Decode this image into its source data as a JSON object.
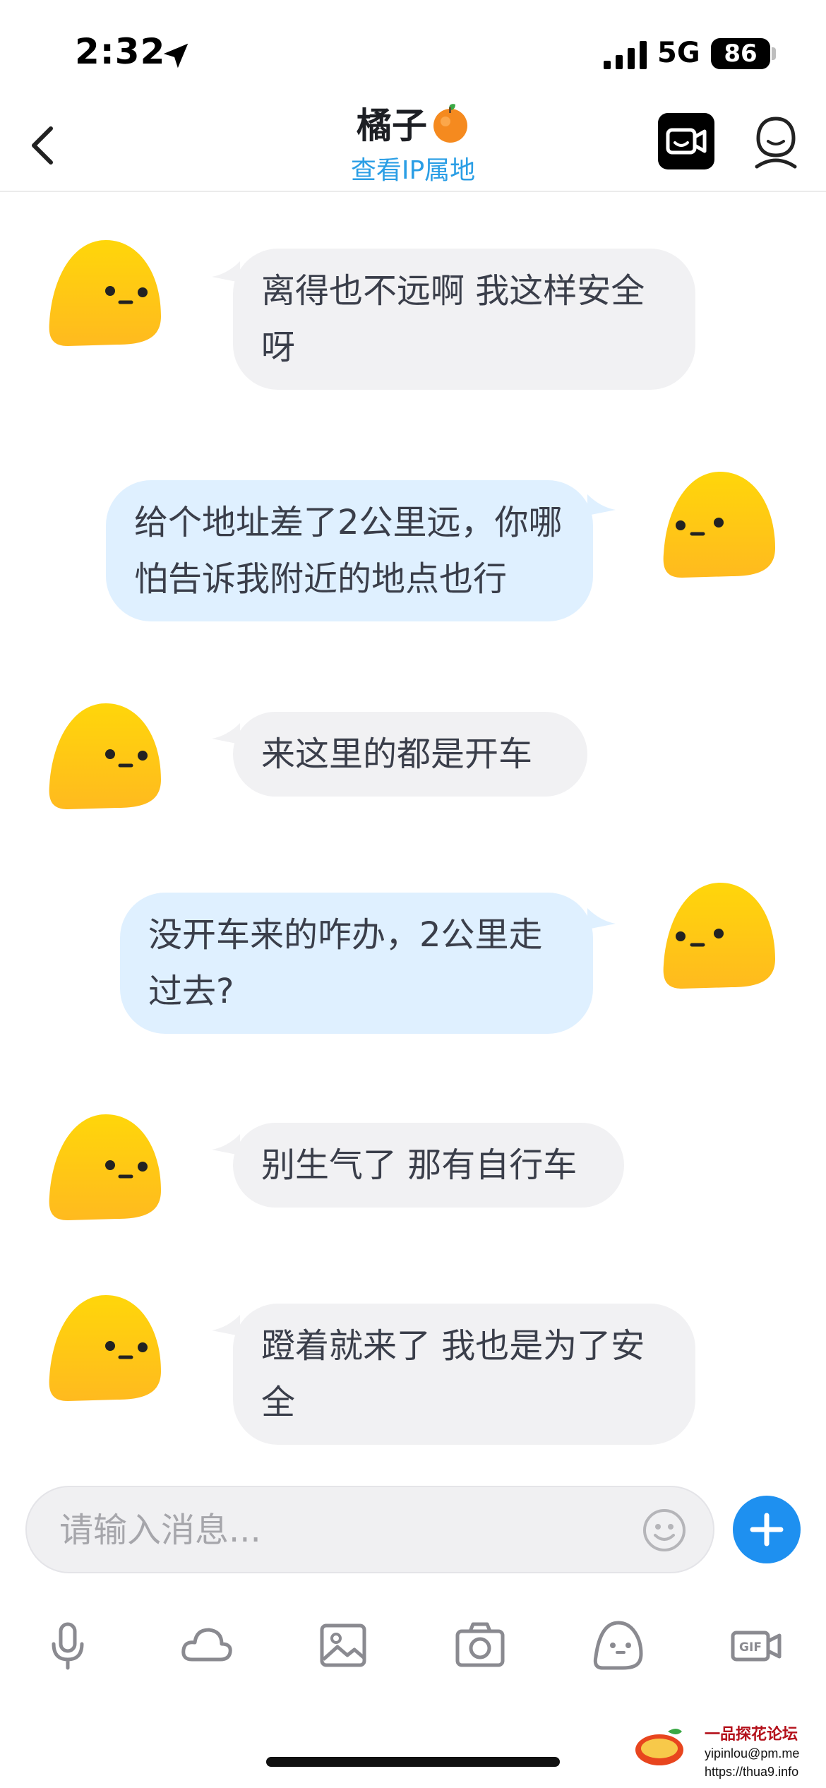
{
  "status": {
    "time": "2:32",
    "network": "5G",
    "battery": "86"
  },
  "header": {
    "title": "橘子",
    "subtitle": "查看IP属地"
  },
  "messages": [
    {
      "side": "in",
      "text": "离得也不远啊 我这样安全呀"
    },
    {
      "side": "out",
      "text": "给个地址差了2公里远，你哪怕告诉我附近的地点也行"
    },
    {
      "side": "in",
      "text": "来这里的都是开车"
    },
    {
      "side": "out",
      "text": "没开车来的咋办，2公里走过去?"
    },
    {
      "side": "in",
      "text": "别生气了 那有自行车"
    },
    {
      "side": "in",
      "text": "蹬着就来了 我也是为了安全"
    }
  ],
  "input": {
    "placeholder": "请输入消息..."
  },
  "toolbar": [
    "mic-icon",
    "cloud-icon",
    "image-icon",
    "camera-icon",
    "sticker-icon",
    "gif-icon"
  ],
  "watermark": {
    "title": "一品探花论坛",
    "email": "yipinlou@pm.me",
    "url": "https://thua9.info"
  },
  "colors": {
    "accent": "#1e90f0",
    "link": "#2a9ee5",
    "incoming_bubble": "#f1f1f3",
    "outgoing_bubble": "#dff0ff",
    "avatar": "#ffcc00"
  }
}
